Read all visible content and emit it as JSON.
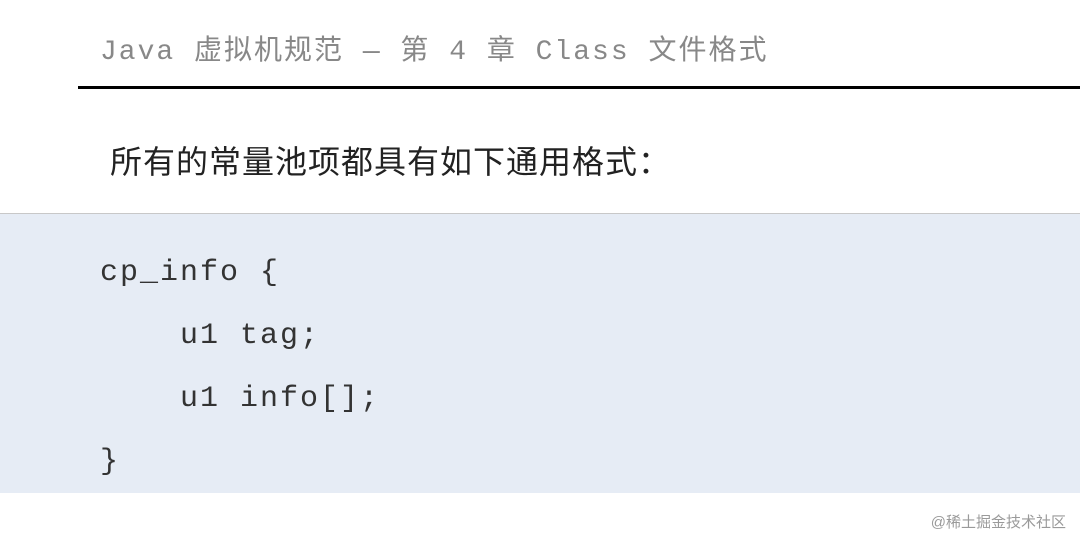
{
  "header": {
    "title": "Java 虚拟机规范 — 第 4 章 Class 文件格式"
  },
  "intro": {
    "text": "所有的常量池项都具有如下通用格式："
  },
  "code": {
    "line1": "cp_info {",
    "line2": "    u1 tag;",
    "line3": "    u1 info[];",
    "line4": "}"
  },
  "watermark": {
    "text": "@稀土掘金技术社区"
  }
}
